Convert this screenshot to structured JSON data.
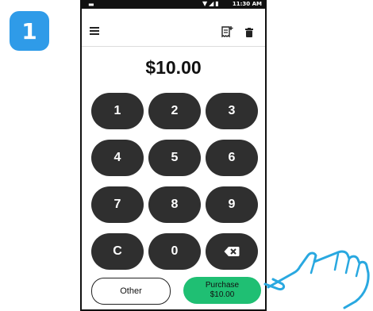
{
  "step": {
    "number": "1"
  },
  "status_bar": {
    "time": "11:30 AM"
  },
  "amount": "$10.00",
  "keypad": {
    "keys": [
      {
        "label": "1"
      },
      {
        "label": "2"
      },
      {
        "label": "3"
      },
      {
        "label": "4"
      },
      {
        "label": "5"
      },
      {
        "label": "6"
      },
      {
        "label": "7"
      },
      {
        "label": "8"
      },
      {
        "label": "9"
      },
      {
        "label": "C"
      },
      {
        "label": "0"
      },
      {
        "icon": "backspace-icon"
      }
    ]
  },
  "actions": {
    "other_label": "Other",
    "purchase_label": "Purchase",
    "purchase_amount": "$10.00"
  },
  "colors": {
    "step_badge": "#2f9be8",
    "key_bg": "#2f2f2f",
    "purchase_bg": "#1fbf73",
    "hand_outline": "#29a8e0"
  }
}
